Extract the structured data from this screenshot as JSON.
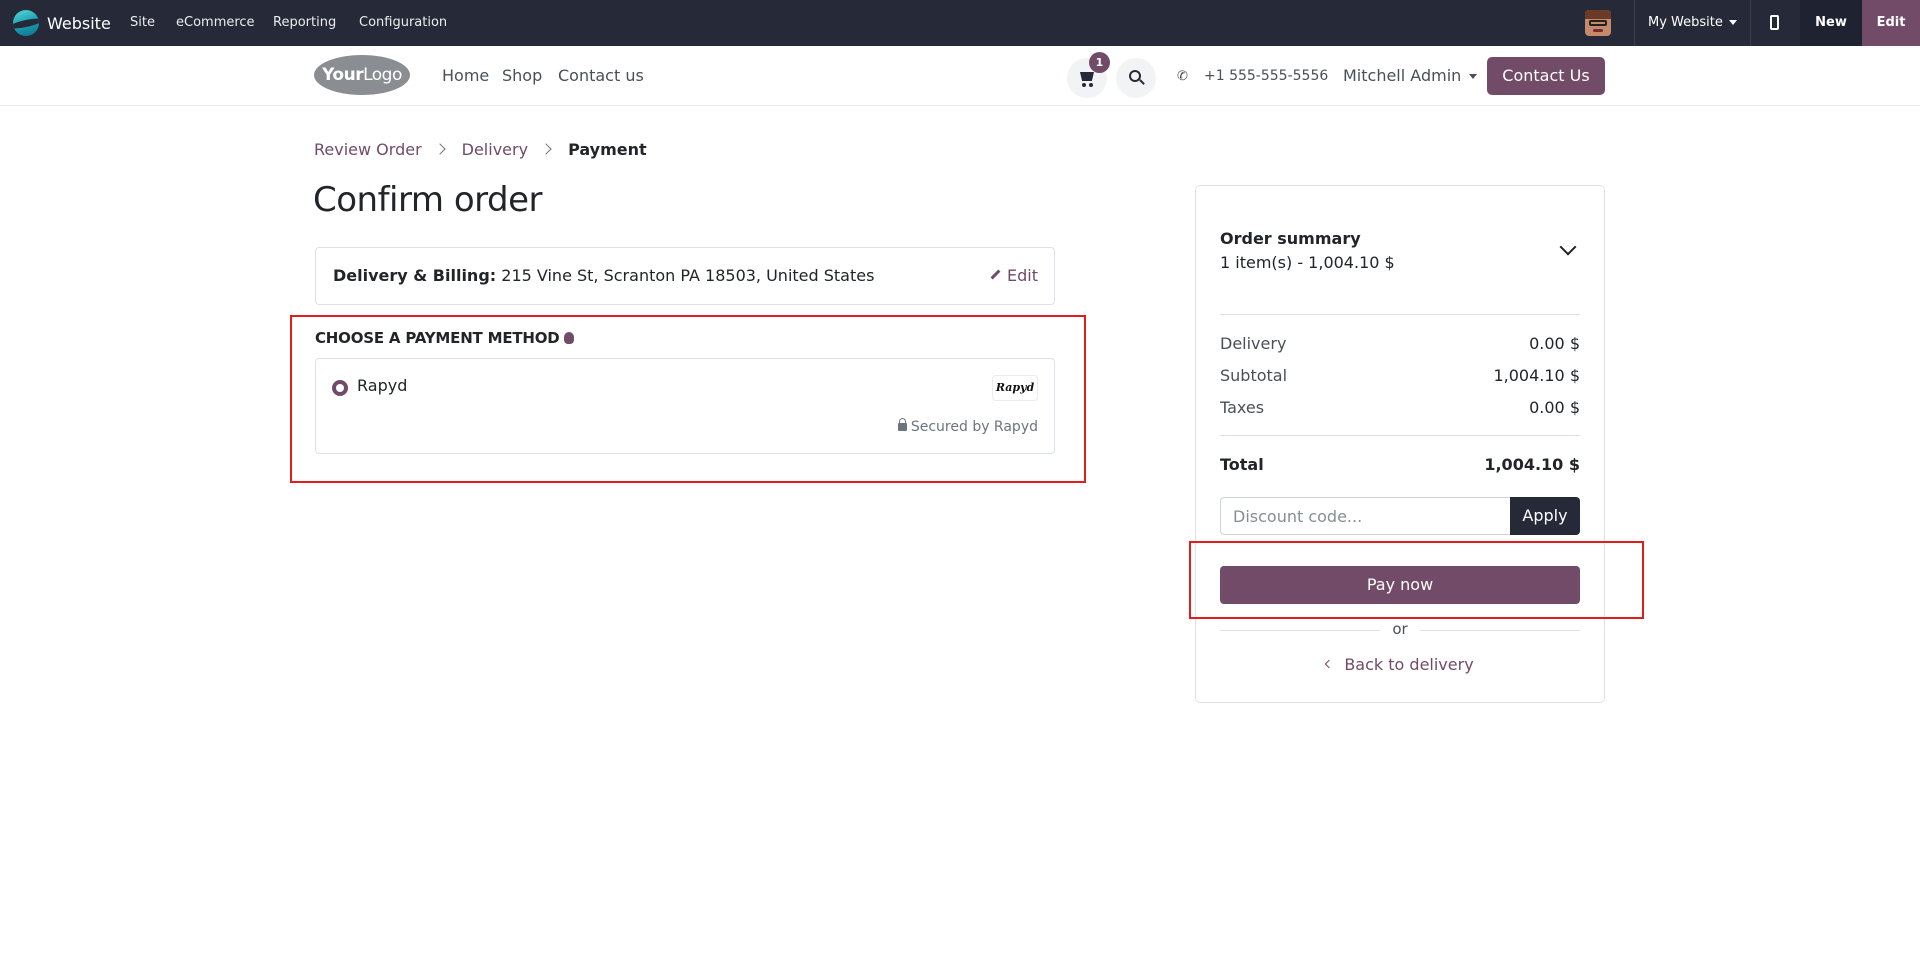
{
  "adminbar": {
    "app_name": "Website",
    "menu": [
      "Site",
      "eCommerce",
      "Reporting",
      "Configuration"
    ],
    "website_selector": "My Website",
    "new_label": "New",
    "edit_label": "Edit"
  },
  "header": {
    "logo_text_bold": "Your",
    "logo_text": "Logo",
    "nav": [
      "Home",
      "Shop",
      "Contact us"
    ],
    "cart_count": "1",
    "phone": "+1 555-555-5556",
    "user": "Mitchell Admin",
    "contact_button": "Contact Us"
  },
  "breadcrumb": {
    "step1": "Review Order",
    "step2": "Delivery",
    "step3": "Payment"
  },
  "title": "Confirm order",
  "address": {
    "label": "Delivery & Billing:",
    "value": "215 Vine St, Scranton PA 18503, United States",
    "edit": "Edit"
  },
  "payment": {
    "heading": "CHOOSE A PAYMENT METHOD",
    "method": "Rapyd",
    "logo_text": "Rapyd",
    "secured": "Secured by Rapyd"
  },
  "summary": {
    "title": "Order summary",
    "items": "1 item(s) -  1,004.10 $",
    "rows": [
      {
        "label": "Delivery",
        "value": "0.00 $"
      },
      {
        "label": "Subtotal",
        "value": "1,004.10 $"
      },
      {
        "label": "Taxes",
        "value": "0.00 $"
      }
    ],
    "total_label": "Total",
    "total_value": "1,004.10 $",
    "discount_placeholder": "Discount code...",
    "apply": "Apply",
    "pay_now": "Pay now",
    "or": "or",
    "back": "Back to delivery"
  },
  "colors": {
    "brand": "#714b67",
    "adminbar": "#262938",
    "highlight": "#e11d1d"
  }
}
